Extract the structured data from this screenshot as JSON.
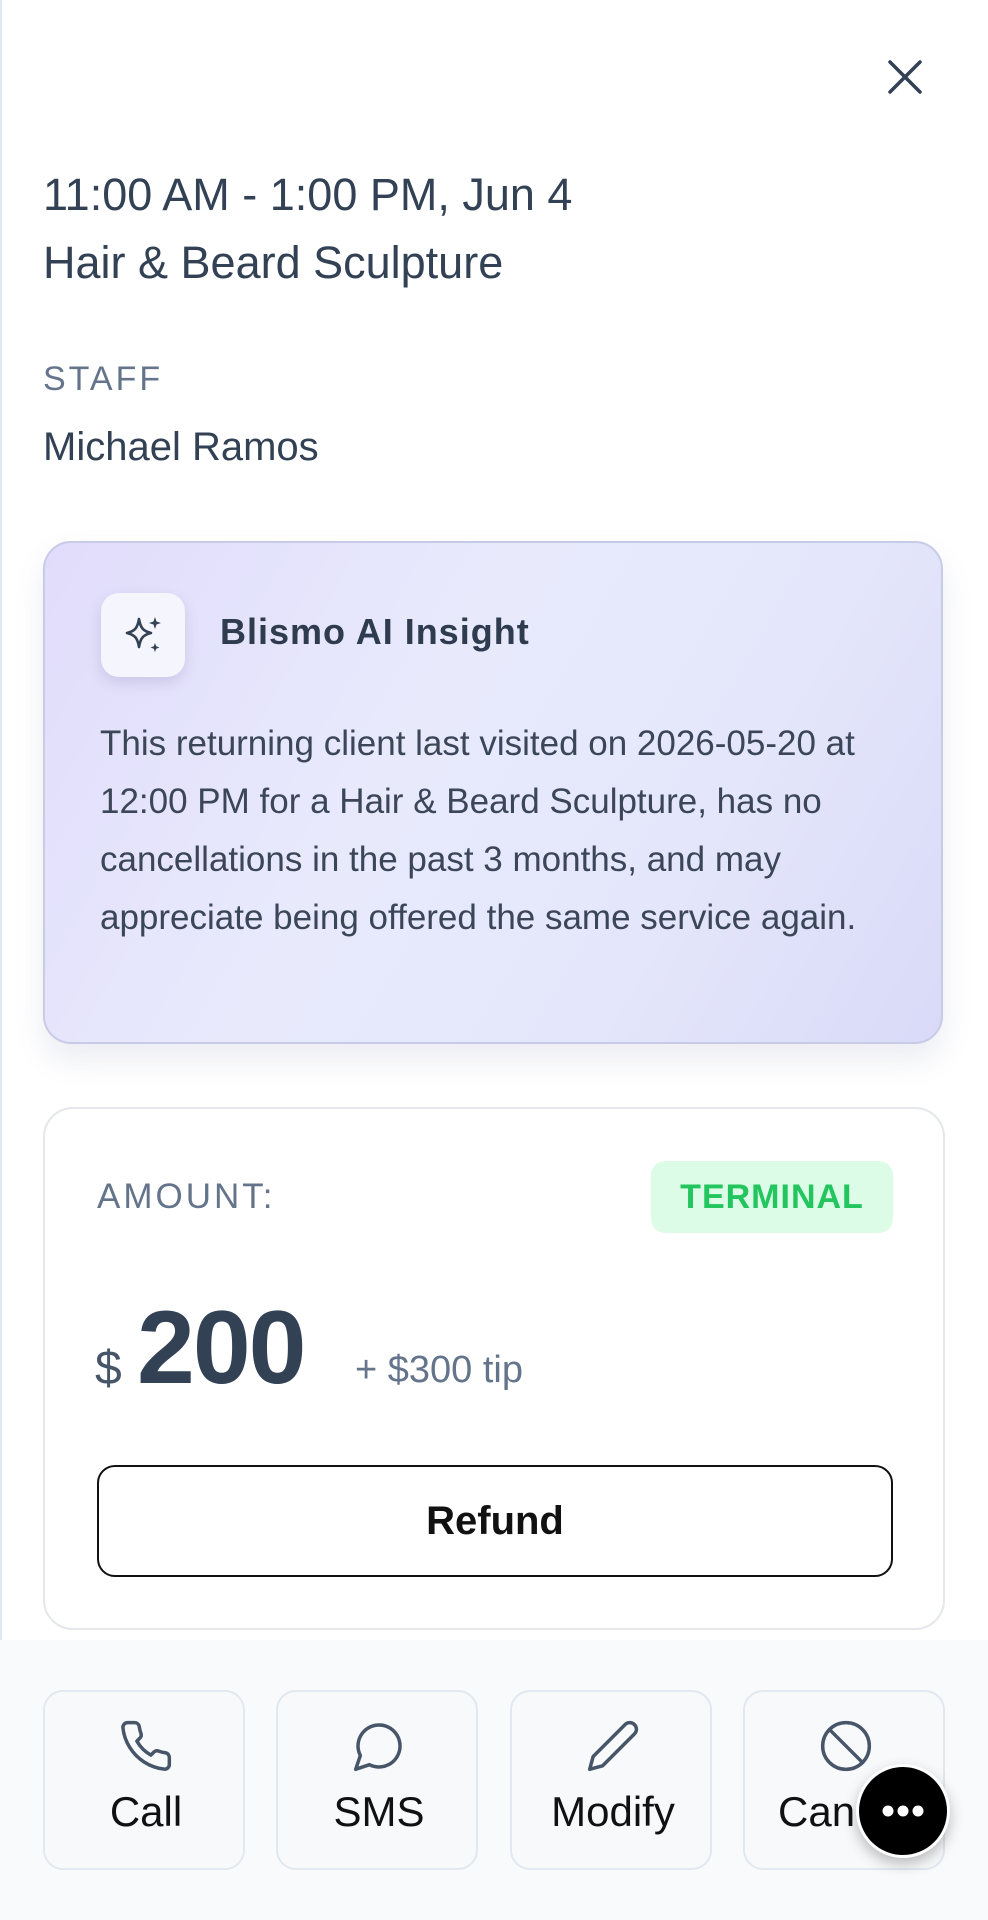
{
  "header": {
    "time_date": "11:00 AM - 1:00 PM, Jun 4",
    "service": "Hair & Beard Sculpture",
    "close_icon": "close-icon"
  },
  "staff": {
    "label": "STAFF",
    "name": "Michael Ramos"
  },
  "ai_insight": {
    "icon": "sparkles-icon",
    "title": "Blismo AI Insight",
    "text": "This returning client last visited on 2026-05-20 at 12:00 PM for a Hair & Beard Sculpture, has no cancellations in the past 3 months, and may appreciate being offered the same service again."
  },
  "payment": {
    "amount_label": "AMOUNT:",
    "badge": "TERMINAL",
    "badge_color": "#22c55e",
    "currency_symbol": "$",
    "amount": "200",
    "tip": "+ $300 tip",
    "refund_label": "Refund"
  },
  "actions": [
    {
      "label": "Call",
      "icon": "phone-icon"
    },
    {
      "label": "SMS",
      "icon": "chat-bubble-icon"
    },
    {
      "label": "Modify",
      "icon": "pencil-icon"
    },
    {
      "label": "Cancel",
      "icon": "ban-icon"
    }
  ],
  "fab": {
    "icon": "more-horizontal-icon"
  }
}
